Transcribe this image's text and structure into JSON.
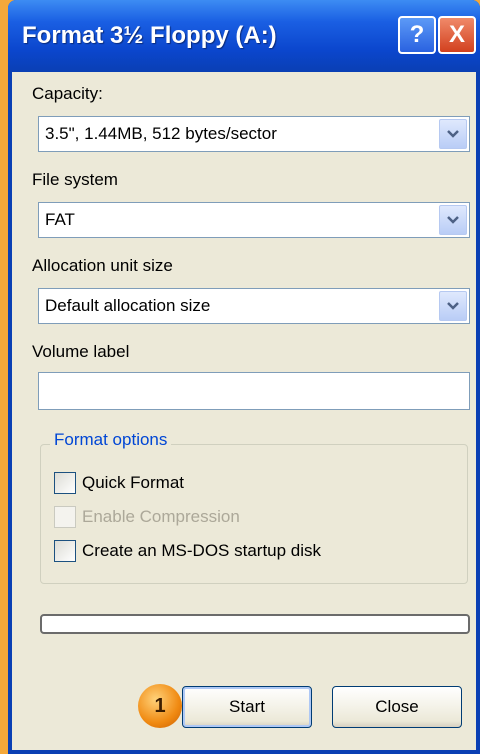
{
  "window": {
    "title": "Format 3½ Floppy (A:)",
    "help_label": "?",
    "close_label": "X"
  },
  "capacity": {
    "label": "Capacity:",
    "value": "3.5\",  1.44MB, 512 bytes/sector"
  },
  "file_system": {
    "label": "File system",
    "value": "FAT"
  },
  "allocation": {
    "label": "Allocation unit size",
    "value": "Default allocation size"
  },
  "volume": {
    "label": "Volume label",
    "value": ""
  },
  "format_options": {
    "title": "Format options",
    "quick_format": "Quick Format",
    "enable_compression": "Enable Compression",
    "msdos_startup": "Create an MS-DOS startup disk"
  },
  "progress": {
    "value": 0
  },
  "buttons": {
    "start": "Start",
    "close": "Close"
  },
  "annotation": {
    "step": "1"
  },
  "colors": {
    "title_bar": "#0a3fb4",
    "dialog_bg": "#ece9d8",
    "group_title": "#0046d5",
    "badge": "#f08a12",
    "desktop": "#f4a83a"
  }
}
